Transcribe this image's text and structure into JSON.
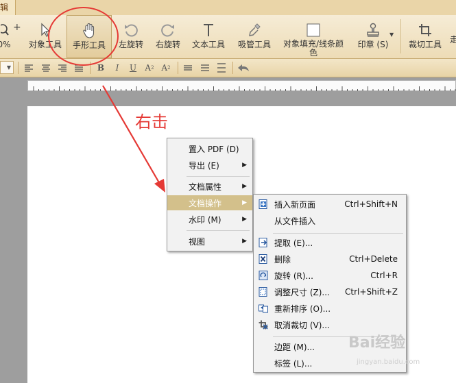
{
  "tab_fragment": "辑",
  "toolbar": {
    "zoom_pct": "0%",
    "zoom_plus": "+",
    "object_tool": "对象工具",
    "hand_tool": "手形工具",
    "rotate_left": "左旋转",
    "rotate_right": "右旋转",
    "text_tool": "文本工具",
    "eyedropper_tool": "吸管工具",
    "fill_line_color": "对象填充/线条颜色",
    "stamp": "印章 (S)",
    "crop_tool": "裁切工具",
    "more_fragment": "走"
  },
  "format_bar": {
    "bold": "B",
    "italic": "I",
    "underline": "U",
    "superscript": "A",
    "sup_mark": "2",
    "subscript": "A",
    "sub_mark": "2"
  },
  "annotation": "右击",
  "context_menu": {
    "items": [
      {
        "label": "置入 PDF (D)"
      },
      {
        "label": "导出 (E)"
      },
      {
        "label": "文档属性"
      },
      {
        "label": "文档操作"
      },
      {
        "label": "水印 (M)"
      },
      {
        "label": "视图"
      }
    ]
  },
  "submenu": {
    "items": [
      {
        "label": "插入新页面",
        "shortcut": "Ctrl+Shift+N"
      },
      {
        "label": "从文件插入",
        "shortcut": ""
      },
      {
        "label": "提取 (E)...",
        "shortcut": ""
      },
      {
        "label": "删除",
        "shortcut": "Ctrl+Delete"
      },
      {
        "label": "旋转 (R)...",
        "shortcut": "Ctrl+R"
      },
      {
        "label": "调整尺寸 (Z)...",
        "shortcut": "Ctrl+Shift+Z"
      },
      {
        "label": "重新排序 (O)...",
        "shortcut": ""
      },
      {
        "label": "取消裁切 (V)...",
        "shortcut": ""
      },
      {
        "label": "边距 (M)...",
        "shortcut": ""
      },
      {
        "label": "标签 (L)...",
        "shortcut": ""
      }
    ]
  },
  "watermark": {
    "text": "Bai经验",
    "sub": "jingyan.baidu.com"
  },
  "colors": {
    "accent_red": "#e53935",
    "menu_highlight": "#d3c08b",
    "ribbon": "#f2e5c6"
  }
}
